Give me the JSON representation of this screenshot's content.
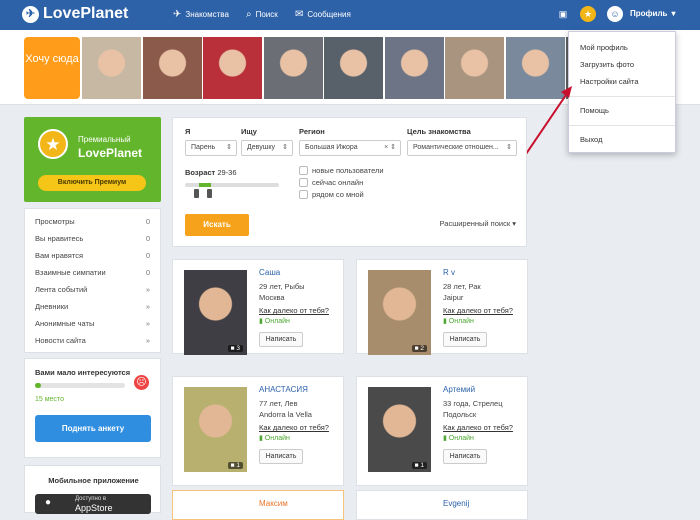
{
  "header": {
    "logo": "LovePlanet",
    "nav": [
      "Знакомства",
      "Поиск",
      "Сообщения"
    ],
    "profile": "Профиль"
  },
  "strip": {
    "want": "Хочу сюда",
    "photo_colors": [
      "#c7b8a4",
      "#8c5a4a",
      "#b9303a",
      "#6b6f75",
      "#58606a",
      "#6c7485",
      "#a9947f",
      "#7a8a9c",
      "#5c5f62"
    ]
  },
  "dropdown": [
    "Мой профиль",
    "Загрузить фото",
    "Настройки сайта",
    "Помощь",
    "Выход"
  ],
  "premium": {
    "line1": "Премиальный",
    "line2": "LovePlanet",
    "button": "Включить Премиум"
  },
  "stats": [
    {
      "label": "Просмотры",
      "value": "0"
    },
    {
      "label": "Вы нравитесь",
      "value": "0"
    },
    {
      "label": "Вам нравятся",
      "value": "0"
    },
    {
      "label": "Взаимные симпатии",
      "value": "0"
    },
    {
      "label": "Лента событий",
      "value": "»"
    },
    {
      "label": "Дневники",
      "value": "»"
    },
    {
      "label": "Анонимные чаты",
      "value": "»"
    },
    {
      "label": "Новости сайта",
      "value": "»"
    }
  ],
  "interest": {
    "title": "Вами мало интересуются",
    "place": "15 место",
    "button": "Поднять анкету",
    "progress": 0.07
  },
  "mobile": {
    "title": "Мобильное приложение",
    "store_top": "Доступно в",
    "store": "AppStore"
  },
  "search": {
    "labels": {
      "i": "Я",
      "seek": "Ищу",
      "region": "Регион",
      "goal": "Цель знакомства"
    },
    "i_value": "Парень",
    "seek_value": "Девушку",
    "region_value": "Большая Ижора",
    "goal_value": "Романтические отношен...",
    "age_label": "Возраст",
    "age_range": "29-36",
    "checks": [
      "новые пользователи",
      "сейчас онлайн",
      "рядом со мной"
    ],
    "button": "Искать",
    "advanced": "Расширенный поиск ▾"
  },
  "cards": [
    {
      "name": "Саша",
      "info": "29 лет, Рыбы",
      "city": "Москва",
      "far": "Как далеко от тебя?",
      "online": "Онлайн",
      "count": "3",
      "write": "Написать",
      "color": "#3e3e44"
    },
    {
      "name": "R v",
      "info": "28 лет, Рак",
      "city": "Jaipur",
      "far": "Как далеко от тебя?",
      "online": "Онлайн",
      "count": "2",
      "write": "Написать",
      "color": "#a88d6c"
    },
    {
      "name": "АНАСТАСИЯ",
      "info": "77 лет, Лев",
      "city": "Andorra la Vella",
      "far": "Как далеко от тебя?",
      "online": "Онлайн",
      "count": "1",
      "write": "Написать",
      "color": "#b8b06f"
    },
    {
      "name": "Артемий",
      "info": "33 года, Стрелец",
      "city": "Подольск",
      "far": "Как далеко от тебя?",
      "online": "Онлайн",
      "count": "1",
      "write": "Написать",
      "color": "#4a4a4a"
    },
    {
      "name": "Максим",
      "color": "#ffffff"
    },
    {
      "name": "Evgenij",
      "color": "#ffffff"
    }
  ]
}
